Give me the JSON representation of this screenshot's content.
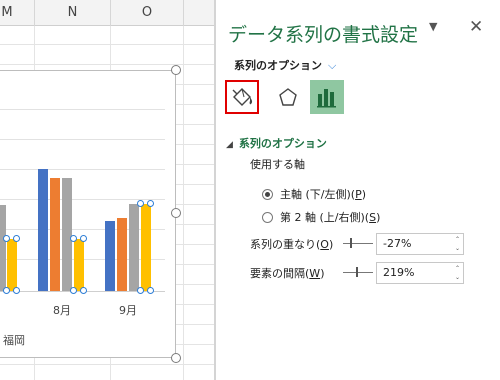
{
  "sheet": {
    "columns": [
      "M",
      "N",
      "O"
    ]
  },
  "chart": {
    "months": [
      "8月",
      "9月"
    ],
    "legend_fragment": "福岡",
    "series_colors": [
      "#4472c4",
      "#ed7d31",
      "#a5a5a5",
      "#ffc000"
    ]
  },
  "pane": {
    "title": "データ系列の書式設定",
    "menu_icon": "▼",
    "close_icon": "✕",
    "options_dropdown": "系列のオプション",
    "options_chevron": "⌵",
    "section_title": "系列のオプション",
    "axis_label": "使用する軸",
    "radio_primary": {
      "label_pre": "主軸 (下/左側)(",
      "key": "P",
      "label_post": ")"
    },
    "radio_secondary": {
      "label_pre": "第 2 軸 (上/右側)(",
      "key": "S",
      "label_post": ")"
    },
    "overlap": {
      "label_pre": "系列の重なり(",
      "key": "O",
      "label_post": ")",
      "value": "-27%"
    },
    "gap": {
      "label_pre": "要素の間隔(",
      "key": "W",
      "label_post": ")",
      "value": "219%"
    }
  }
}
